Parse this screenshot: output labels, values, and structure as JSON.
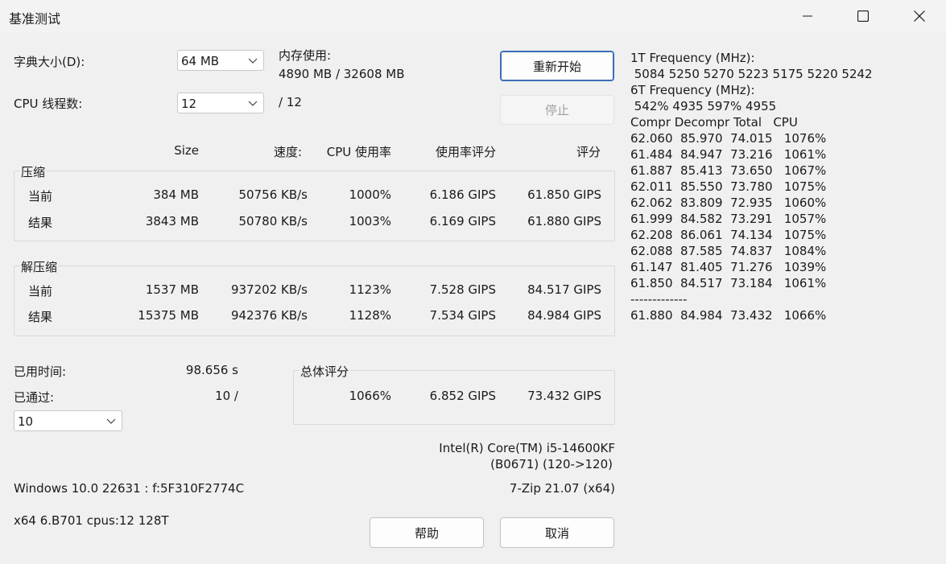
{
  "window": {
    "title": "基准测试",
    "minimize_icon": "minimize-icon",
    "maximize_icon": "maximize-icon",
    "close_icon": "close-icon"
  },
  "settings": {
    "dict_label": "字典大小(D):",
    "dict_value": "64 MB",
    "threads_label": "CPU 线程数:",
    "threads_value": "12",
    "threads_max": "/ 12",
    "memory_label": "内存使用:",
    "memory_value": "4890 MB / 32608 MB"
  },
  "buttons": {
    "restart": "重新开始",
    "stop": "停止",
    "help": "帮助",
    "cancel": "取消"
  },
  "columns": {
    "size": "Size",
    "speed": "速度:",
    "cpu_usage": "CPU 使用率",
    "usage_rating": "使用率评分",
    "rating": "评分"
  },
  "compress": {
    "title": "压缩",
    "rows": [
      {
        "label": "当前",
        "size": "384 MB",
        "speed": "50756 KB/s",
        "usage": "1000%",
        "usage_rating": "6.186 GIPS",
        "rating": "61.850 GIPS"
      },
      {
        "label": "结果",
        "size": "3843 MB",
        "speed": "50780 KB/s",
        "usage": "1003%",
        "usage_rating": "6.169 GIPS",
        "rating": "61.880 GIPS"
      }
    ]
  },
  "decompress": {
    "title": "解压缩",
    "rows": [
      {
        "label": "当前",
        "size": "1537 MB",
        "speed": "937202 KB/s",
        "usage": "1123%",
        "usage_rating": "7.528 GIPS",
        "rating": "84.517 GIPS"
      },
      {
        "label": "结果",
        "size": "15375 MB",
        "speed": "942376 KB/s",
        "usage": "1128%",
        "usage_rating": "7.534 GIPS",
        "rating": "84.984 GIPS"
      }
    ]
  },
  "status": {
    "elapsed_label": "已用时间:",
    "elapsed_value": "98.656 s",
    "passes_label": "已通过:",
    "passes_value": "10 /",
    "passes_select": "10"
  },
  "total": {
    "title": "总体评分",
    "usage": "1066%",
    "usage_rating": "6.852 GIPS",
    "rating": "73.432 GIPS"
  },
  "system": {
    "cpu_line1": "Intel(R) Core(TM) i5-14600KF",
    "cpu_line2": "(B0671) (120->120)",
    "os": "Windows 10.0 22631 : f:5F310F2774C",
    "version": "7-Zip 21.07 (x64)",
    "arch": "x64 6.B701 cpus:12 128T"
  },
  "freq_log": [
    "1T Frequency (MHz):",
    " 5084 5250 5270 5223 5175 5220 5242",
    "6T Frequency (MHz):",
    " 542% 4935 597% 4955",
    "Compr Decompr Total   CPU",
    "62.060  85.970  74.015   1076%",
    "61.484  84.947  73.216   1061%",
    "61.887  85.413  73.650   1067%",
    "62.011  85.550  73.780   1075%",
    "62.062  83.809  72.935   1060%",
    "61.999  84.582  73.291   1057%",
    "62.208  86.061  74.134   1075%",
    "62.088  87.585  74.837   1084%",
    "61.147  81.405  71.276   1039%",
    "61.850  84.517  73.184   1061%",
    "-------------",
    "61.880  84.984  73.432   1066%"
  ]
}
